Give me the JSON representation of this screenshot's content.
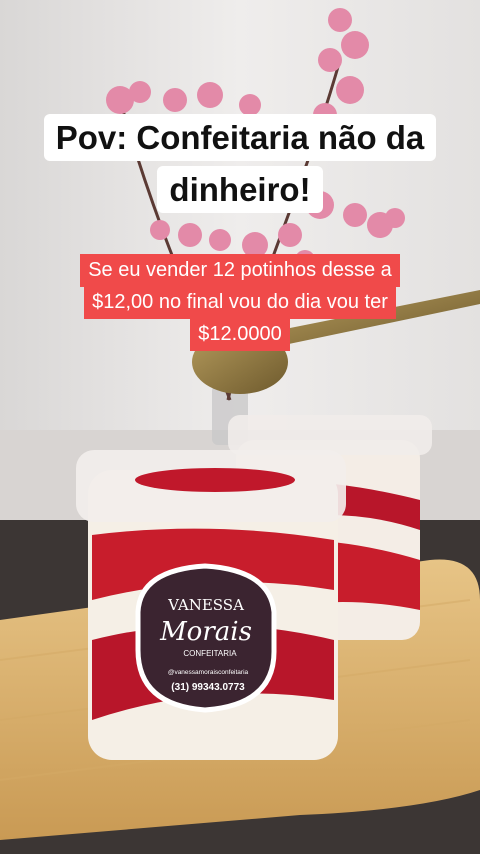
{
  "overlay": {
    "title_line1": "Pov: Confeitaria não da",
    "title_line2": "dinheiro!",
    "sub_line1": "Se eu vender 12 potinhos desse a",
    "sub_line2": "$12,00 no final vou do dia vou ter",
    "sub_line3": "$12.0000"
  },
  "label": {
    "brand": "VANESSA",
    "brand_script": "Morais",
    "tagline": "CONFEITARIA",
    "handle": "@vanessamoraisconfeitaria",
    "phone": "(31) 99343.0773"
  },
  "colors": {
    "title_bg": "#ffffff",
    "sub_bg": "#f04a4a",
    "label_bg": "#3b2430",
    "cake_red": "#c81d2c",
    "cream": "#f5efe6"
  }
}
